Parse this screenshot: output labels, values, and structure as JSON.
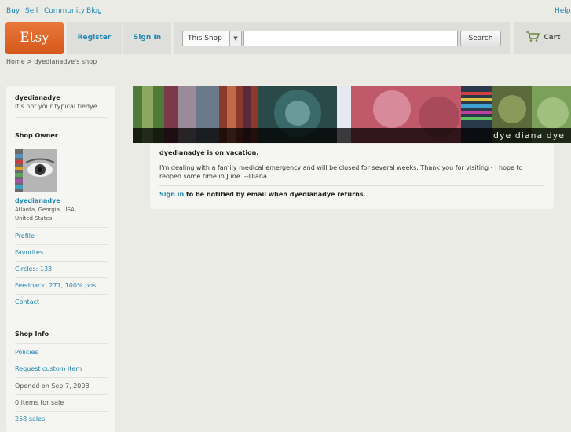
{
  "topnav": {
    "buy": "Buy",
    "sell": "Sell",
    "community": "Community",
    "blog": "Blog",
    "help": "Help"
  },
  "header": {
    "logo": "Etsy",
    "register": "Register",
    "sign_in": "Sign In",
    "search_scope": "This Shop",
    "search_value": "",
    "search_button": "Search",
    "cart": "Cart"
  },
  "breadcrumb": "Home > dyedianadye's shop",
  "sidebar": {
    "shop_name": "dyedianadye",
    "tagline": "it's not your typical tiedye",
    "owner_heading": "Shop Owner",
    "owner_name": "dyedianadye",
    "location_line1": "Atlanta, Georgia, USA,",
    "location_line2": "United States",
    "links": [
      "Profile",
      "Favorites",
      "Circles: 133",
      "Feedback: 277, 100% pos.",
      "Contact"
    ],
    "info_heading": "Shop Info",
    "policies": "Policies",
    "request": "Request custom item",
    "opened": "Opened on Sep 7, 2008",
    "items": "0 items for sale",
    "sales": "258 sales"
  },
  "banner": {
    "title": "dye diana dye"
  },
  "notice": {
    "heading": "dyedianadye is on vacation.",
    "message": "I'm dealing with a family medical emergency and will be closed for several weeks. Thank you for visiting - I hope to reopen some time in June. --Diana",
    "sign_in_link": "Sign in",
    "sign_in_rest": " to be notified by email when dyedianadye returns."
  }
}
